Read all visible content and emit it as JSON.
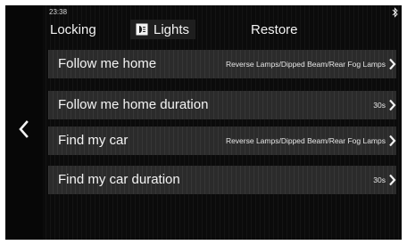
{
  "status": {
    "time": "23:38"
  },
  "tabs": [
    {
      "label": "Locking",
      "active": false
    },
    {
      "label": "Lights",
      "active": true,
      "icon": "headlight-icon"
    },
    {
      "label": "Restore",
      "active": false
    }
  ],
  "settings": [
    {
      "label": "Follow me home",
      "value": "Reverse Lamps/Dipped Beam/Rear Fog Lamps"
    },
    {
      "label": "Follow me home duration",
      "value": "30s"
    },
    {
      "label": "Find my car",
      "value": "Reverse Lamps/Dipped Beam/Rear Fog Lamps"
    },
    {
      "label": "Find my car duration",
      "value": "30s"
    }
  ],
  "colors": {
    "background": "#0b0b0b",
    "row": "#2b2b2b",
    "text": "#f4f4f4",
    "active_tab": "#1e1e1e"
  },
  "icons": {
    "back": "chevron-left-icon",
    "bluetooth": "bluetooth-icon",
    "row_arrow": "chevron-right-icon"
  }
}
